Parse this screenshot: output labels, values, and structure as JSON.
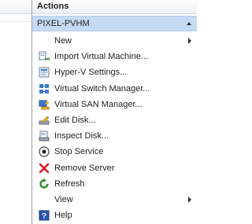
{
  "actions": {
    "header": "Actions",
    "group": "PIXEL-PVHM",
    "items": [
      {
        "label": "New",
        "icon": "none"
      },
      {
        "label": "Import Virtual Machine...",
        "icon": "import-vm-icon"
      },
      {
        "label": "Hyper-V Settings...",
        "icon": "hyperv-settings-icon"
      },
      {
        "label": "Virtual Switch Manager...",
        "icon": "virtual-switch-icon"
      },
      {
        "label": "Virtual SAN Manager...",
        "icon": "virtual-san-icon"
      },
      {
        "label": "Edit Disk...",
        "icon": "edit-disk-icon"
      },
      {
        "label": "Inspect Disk...",
        "icon": "inspect-disk-icon"
      },
      {
        "label": "Stop Service",
        "icon": "stop-service-icon"
      },
      {
        "label": "Remove Server",
        "icon": "remove-server-icon"
      },
      {
        "label": "Refresh",
        "icon": "refresh-icon"
      },
      {
        "label": "View",
        "icon": "none"
      },
      {
        "label": "Help",
        "icon": "help-icon"
      }
    ]
  },
  "colors": {
    "group_header_bg": "#c5dbf3",
    "remove_red": "#d51c1c",
    "refresh_green": "#2f8f2f",
    "help_blue": "#2a55b5"
  }
}
